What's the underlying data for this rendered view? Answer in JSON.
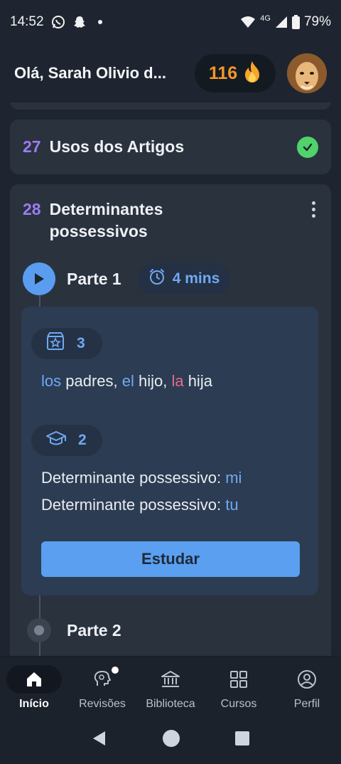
{
  "status_bar": {
    "time": "14:52",
    "network": "4G",
    "battery": "79%",
    "icons": [
      "whatsapp-icon",
      "snapchat-icon",
      "wifi-icon",
      "signal-icon",
      "battery-icon"
    ]
  },
  "header": {
    "greeting": "Olá, Sarah Olivio d...",
    "streak_count": "116",
    "streak_icon": "fire-icon"
  },
  "lessons": [
    {
      "number": "27",
      "title": "Usos dos Artigos",
      "status": "completed"
    },
    {
      "number": "28",
      "title": "Determinantes possessivos",
      "parts": [
        {
          "label": "Parte 1",
          "duration": "4 mins",
          "vocab_count": "3",
          "vocab_sentence": [
            {
              "text": "los",
              "style": "blue"
            },
            {
              "text": " padres, ",
              "style": "plain"
            },
            {
              "text": "el",
              "style": "blue"
            },
            {
              "text": " hijo, ",
              "style": "plain"
            },
            {
              "text": "la",
              "style": "pink"
            },
            {
              "text": " hija",
              "style": "plain"
            }
          ],
          "grammar_count": "2",
          "grammar_lines": [
            {
              "prefix": "Determinante possessivo: ",
              "word": "mi"
            },
            {
              "prefix": "Determinante possessivo: ",
              "word": "tu"
            }
          ],
          "study_button": "Estudar"
        },
        {
          "label": "Parte 2"
        }
      ]
    }
  ],
  "bottom_nav": [
    {
      "label": "Início",
      "icon": "home-icon",
      "active": true
    },
    {
      "label": "Revisões",
      "icon": "brain-icon",
      "active": false
    },
    {
      "label": "Biblioteca",
      "icon": "library-icon",
      "active": false
    },
    {
      "label": "Cursos",
      "icon": "grid-icon",
      "active": false
    },
    {
      "label": "Perfil",
      "icon": "profile-icon",
      "active": false
    }
  ],
  "colors": {
    "background": "#1e2530",
    "card": "#2a323e",
    "accent_blue": "#5b9ff0",
    "accent_purple": "#9b7cf2",
    "streak_orange": "#f6952c",
    "success_green": "#4fd36a",
    "article_pink": "#e26b8f"
  }
}
